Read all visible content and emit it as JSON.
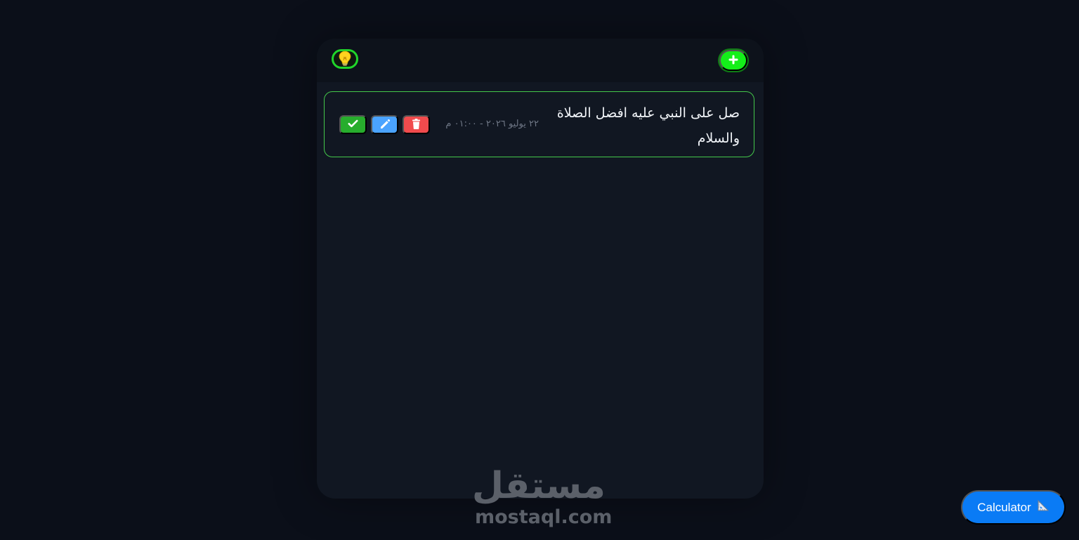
{
  "toolbar": {
    "theme_icon": "lightbulb-icon",
    "add_icon": "plus-icon"
  },
  "tasks": [
    {
      "text": "صل على النبي عليه افضل الصلاة والسلام",
      "date": "٢٢ يوليو ٢٠٢٦ - ٠١:٠٠ م",
      "actions": {
        "complete_icon": "check-icon",
        "edit_icon": "pencil-icon",
        "delete_icon": "trash-icon"
      }
    }
  ],
  "watermark": {
    "arabic": "مستقل",
    "latin": "mostaql.com"
  },
  "calculator": {
    "label": "Calculator",
    "icon": "ruler-triangle-icon"
  },
  "colors": {
    "background": "#0b0f19",
    "panel": "#111722",
    "header": "#0d121b",
    "accent_green": "#14ef1a",
    "card_border": "#44c84a",
    "complete": "#27ad2d",
    "edit": "#4aa3ff",
    "delete": "#f14b4d",
    "calculator": "#0a7bf5"
  }
}
